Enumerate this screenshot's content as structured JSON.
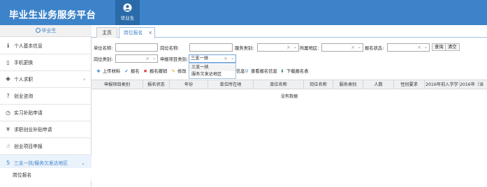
{
  "header": {
    "app_title": "毕业生业务服务平台",
    "user_label": "毕业生"
  },
  "sidebar": {
    "user_name": "毕业生",
    "items": [
      {
        "icon": "info-icon",
        "label": "个人基本信息",
        "glyph": "ℹ"
      },
      {
        "icon": "phone-icon",
        "label": "手机更换",
        "glyph": "▯"
      },
      {
        "icon": "plus-icon",
        "label": "个人求职",
        "glyph": "✚",
        "arrow": "‹"
      },
      {
        "icon": "question-icon",
        "label": "创业咨询",
        "glyph": "?"
      },
      {
        "icon": "clock-icon",
        "label": "实习补贴申请",
        "glyph": "◷"
      },
      {
        "icon": "money-icon",
        "label": "求职创业补贴申请",
        "glyph": "¥"
      },
      {
        "icon": "hand-icon",
        "label": "创业项目申报",
        "glyph": "☝"
      },
      {
        "icon": "html5-icon",
        "label": "三支一扶/服务欠发达地区",
        "glyph": "5",
        "arrow": "⌄"
      }
    ],
    "sub_item": "岗位报名"
  },
  "tabs": {
    "home": "主页",
    "active": "岗位报名",
    "close": "×"
  },
  "filters": {
    "unit_name": {
      "label": "单位名称:",
      "value": ""
    },
    "post_name": {
      "label": "岗位名称:",
      "value": ""
    },
    "service_type": {
      "label": "服务类别:",
      "value": ""
    },
    "region": {
      "label": "所属地区:",
      "value": ""
    },
    "report_status": {
      "label": "报名状态:",
      "value": ""
    },
    "query_button": "查询",
    "clear_button": "清空",
    "post_type": {
      "label": "岗位类别:",
      "value": ""
    },
    "project_type": {
      "label": "申报项目类别:",
      "value": "三支一扶"
    },
    "clear_glyph": "×",
    "dropdown_glyph": "⌄"
  },
  "dropdown_options": [
    "三支一扶",
    "服务欠发达地区"
  ],
  "toolbar": [
    {
      "icon": "add-icon",
      "glyph": "✚",
      "label": "上传材料",
      "color": "#3d83c9"
    },
    {
      "icon": "check-icon",
      "glyph": "✔",
      "label": "报名",
      "color": "#3d83c9"
    },
    {
      "icon": "cross-icon",
      "glyph": "✖",
      "label": "报名撤销",
      "color": "#d9302c"
    },
    {
      "icon": "pencil-icon",
      "glyph": "✎",
      "label": "修改",
      "color": "#e0a000"
    },
    {
      "icon": "partial-label",
      "glyph": "",
      "label": "信息",
      "color": "#333"
    },
    {
      "icon": "search-icon",
      "glyph": "⚲",
      "label": "查看报名信息",
      "color": "#3d83c9"
    },
    {
      "icon": "download-icon",
      "glyph": "⬇",
      "label": "下载报名表",
      "color": "#2e8b57"
    }
  ],
  "table": {
    "headers": [
      "申报项目类别",
      "报名状态",
      "年份",
      "单位所在地",
      "单位名称",
      "岗位名称",
      "服务类别",
      "人数",
      "性别要求",
      "2016年前入学学",
      "2016年（含"
    ],
    "empty_text": "没有数据"
  }
}
